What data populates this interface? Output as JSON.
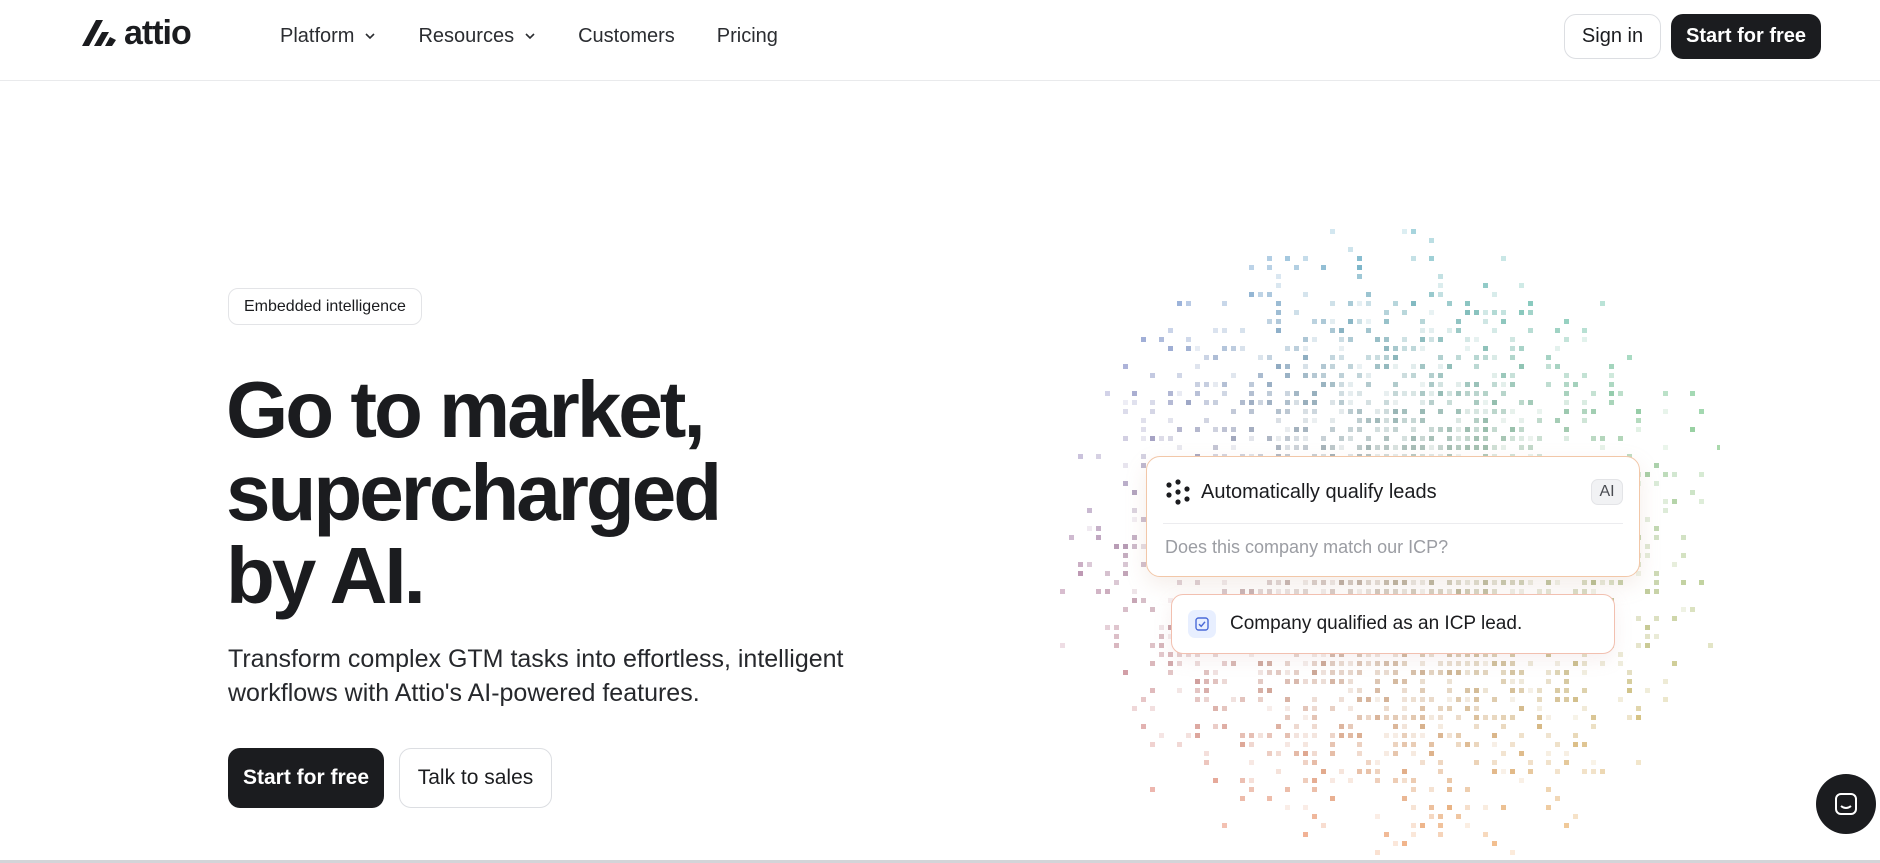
{
  "header": {
    "logo_text": "attio",
    "nav": [
      {
        "label": "Platform",
        "has_dropdown": true
      },
      {
        "label": "Resources",
        "has_dropdown": true
      },
      {
        "label": "Customers",
        "has_dropdown": false
      },
      {
        "label": "Pricing",
        "has_dropdown": false
      }
    ],
    "sign_in_label": "Sign in",
    "start_label": "Start for free"
  },
  "hero": {
    "badge": "Embedded intelligence",
    "headline": [
      "Go to market,",
      "supercharged",
      "by AI."
    ],
    "subcopy": [
      "Transform complex GTM tasks into effortless, intelligent",
      "workflows with Attio's AI-powered features."
    ],
    "primary_cta": "Start for free",
    "secondary_cta": "Talk to sales"
  },
  "ai_card": {
    "icon": "sparkle-dots-icon",
    "title": "Automatically qualify leads",
    "tag": "AI",
    "question": "Does this company match our ICP?"
  },
  "result_card": {
    "icon": "check-square-icon",
    "text": "Company qualified as an ICP lead."
  },
  "chat": {
    "icon": "chat-bubble-icon"
  },
  "colors": {
    "text": "#1b1c1f",
    "accent_dark": "#1b1c1f",
    "field_blue": "#5a7fe0",
    "field_mint": "#3fcf9e",
    "field_red": "#f27a6e",
    "field_amber": "#f2b34a"
  }
}
